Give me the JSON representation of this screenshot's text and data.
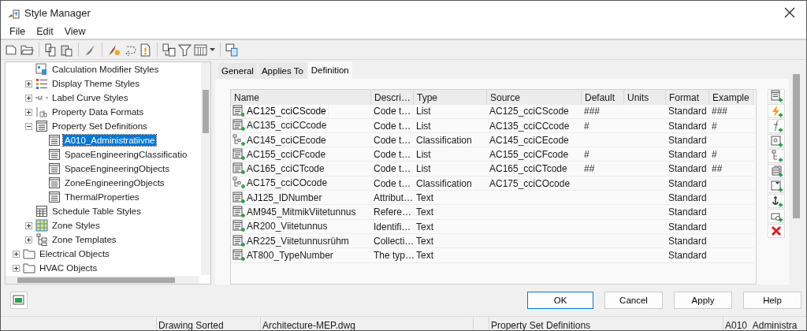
{
  "window": {
    "title": "Style Manager"
  },
  "menu": [
    "File",
    "Edit",
    "View"
  ],
  "tree": [
    {
      "kind": "continuation",
      "children": [
        {
          "label": "Calculation Modifier Styles",
          "kind": "calculation",
          "selected": false
        },
        {
          "label": "Display Theme Styles",
          "kind": "display-theme",
          "expanded": false,
          "selected": false
        },
        {
          "label": "Label Curve Styles",
          "kind": "label-curve",
          "expanded": false,
          "selected": false
        },
        {
          "label": "Property Data Formats",
          "kind": "data-format",
          "expanded": false,
          "selected": false
        },
        {
          "label": "Property Set Definitions",
          "kind": "property-set",
          "expanded": true,
          "selected": false,
          "children": [
            {
              "label": "A010_Administratiivne",
              "kind": "definition",
              "selected": true
            },
            {
              "label": "SpaceEngineeringClassificatio",
              "kind": "definition",
              "selected": false
            },
            {
              "label": "SpaceEngineeringObjects",
              "kind": "definition",
              "selected": false
            },
            {
              "label": "ZoneEngineeringObjects",
              "kind": "definition",
              "selected": false
            },
            {
              "label": "ThermalProperties",
              "kind": "definition",
              "selected": false
            }
          ]
        },
        {
          "label": "Schedule Table Styles",
          "kind": "schedule",
          "selected": false
        },
        {
          "label": "Zone Styles",
          "kind": "zone-style",
          "expanded": false,
          "selected": false
        },
        {
          "label": "Zone Templates",
          "kind": "zone-template",
          "expanded": false,
          "selected": false
        }
      ]
    },
    {
      "label": "Electrical Objects",
      "kind": "folder",
      "expanded": false,
      "selected": false
    },
    {
      "label": "HVAC Objects",
      "kind": "folder",
      "expanded": false,
      "selected": false
    }
  ],
  "tabs": [
    {
      "label": "General",
      "selected": false
    },
    {
      "label": "Applies To",
      "selected": false
    },
    {
      "label": "Definition",
      "selected": true
    }
  ],
  "table": {
    "columns": [
      "Name",
      "Descri…",
      "Type",
      "Source",
      "Default",
      "Units",
      "Format",
      "Example"
    ],
    "rows": [
      {
        "kind": "list",
        "selected": true,
        "name": "AC125_cciCScode",
        "description": "Code t…",
        "type": "List",
        "source": "AC125_cciCScode",
        "default": "###",
        "format": "Standard",
        "example": "###"
      },
      {
        "kind": "list",
        "selected": false,
        "name": "AC135_cciCCcode",
        "description": "Code t…",
        "type": "List",
        "source": "AC135_cciCCcode",
        "default": "#",
        "format": "Standard",
        "example": "#"
      },
      {
        "kind": "classification",
        "selected": false,
        "name": "AC145_cciCEcode",
        "description": "Code t…",
        "type": "Classification",
        "source": "AC145_cciCEcode",
        "format": "Standard"
      },
      {
        "kind": "list",
        "selected": false,
        "name": "AC155_cciCFcode",
        "description": "Code t…",
        "type": "List",
        "source": "AC155_cciCFcode",
        "default": "#",
        "format": "Standard",
        "example": "#"
      },
      {
        "kind": "list",
        "selected": false,
        "name": "AC165_cciCTcode",
        "description": "Code t…",
        "type": "List",
        "source": "AC165_cciCTcode",
        "default": "##",
        "format": "Standard",
        "example": "##"
      },
      {
        "kind": "classification",
        "selected": false,
        "name": "AC175_cciCOcode",
        "description": "Code t…",
        "type": "Classification",
        "source": "AC175_cciCOcode",
        "format": "Standard"
      },
      {
        "kind": "list",
        "selected": false,
        "name": "AJ125_IDNumber",
        "description": "Attribut…",
        "type": "Text",
        "format": "Standard"
      },
      {
        "kind": "list",
        "selected": false,
        "name": "AM945_MitmikViitetunnus",
        "description": "Refere…",
        "type": "Text",
        "format": "Standard"
      },
      {
        "kind": "list",
        "selected": false,
        "name": "AR200_Viitetunnus",
        "description": "Identifi…",
        "type": "Text",
        "format": "Standard"
      },
      {
        "kind": "list",
        "selected": false,
        "name": "AR225_Viitetunnusrühm",
        "description": "Collecti…",
        "type": "Text",
        "format": "Standard"
      },
      {
        "kind": "list",
        "selected": false,
        "name": "AT800_TypeNumber",
        "description": "The typ…",
        "type": "Text",
        "format": "Standard"
      }
    ]
  },
  "buttons": [
    {
      "label": "OK",
      "selected": true
    },
    {
      "label": "Cancel",
      "selected": false
    },
    {
      "label": "Apply",
      "selected": false
    },
    {
      "label": "Help",
      "selected": false
    }
  ],
  "status_bar": [
    "Drawing Sorted",
    "Architecture-MEP.dwg",
    "Property Set Definitions",
    "A010_Administra"
  ]
}
